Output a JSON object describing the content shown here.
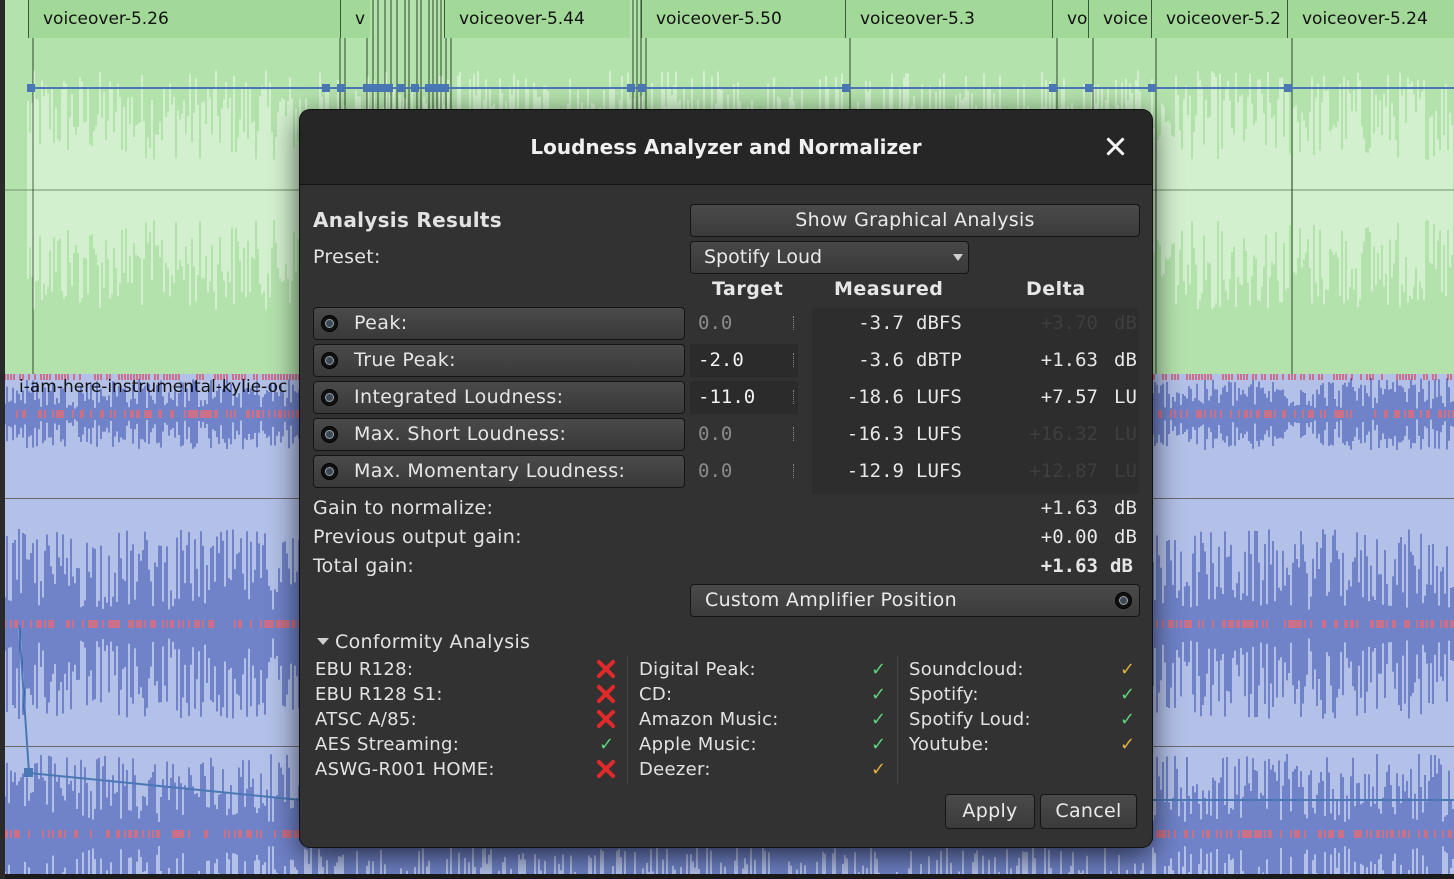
{
  "editor": {
    "voice_regions": [
      {
        "name": "voiceover-5.26"
      },
      {
        "name": "v"
      },
      {
        "name": "voiceover-5.44"
      },
      {
        "name": "voiceover-5.50"
      },
      {
        "name": "voiceover-5.3"
      },
      {
        "name": "vo"
      },
      {
        "name": "voice"
      },
      {
        "name": "voiceover-5.2"
      },
      {
        "name": "voiceover-5.24"
      }
    ],
    "music_region": "i-am-here-instrumental-kylie-oc",
    "colors": {
      "voice_track": "#b4e2ad",
      "voice_wave": "#f2fff0",
      "music_track": "#b3c0e8",
      "music_wave": "#2c44a8",
      "clip_marks": "#e0202a",
      "envelope": "#4a78b5"
    }
  },
  "dialog": {
    "title": "Loudness Analyzer and Normalizer",
    "analysis_results": "Analysis Results",
    "show_graph_button": "Show Graphical Analysis",
    "preset_label": "Preset:",
    "preset_value": "Spotify Loud",
    "col_target": "Target",
    "col_measured": "Measured",
    "col_delta": "Delta",
    "rows": [
      {
        "label": "Peak:",
        "target": "0.0",
        "measured": "-3.7",
        "unit": "dBFS",
        "delta": "+3.70",
        "delta_unit": "dB"
      },
      {
        "label": "True Peak:",
        "target": "-2.0",
        "measured": "-3.6",
        "unit": "dBTP",
        "delta": "+1.63",
        "delta_unit": "dB"
      },
      {
        "label": "Integrated Loudness:",
        "target": "-11.0",
        "measured": "-18.6",
        "unit": "LUFS",
        "delta": "+7.57",
        "delta_unit": "LU"
      },
      {
        "label": "Max. Short Loudness:",
        "target": "0.0",
        "measured": "-16.3",
        "unit": "LUFS",
        "delta": "+16.32",
        "delta_unit": "LU"
      },
      {
        "label": "Max. Momentary Loudness:",
        "target": "0.0",
        "measured": "-12.9",
        "unit": "LUFS",
        "delta": "+12.87",
        "delta_unit": "LU"
      }
    ],
    "gain_normalize_label": "Gain to normalize:",
    "gain_normalize_value": "+1.63",
    "prev_output_label": "Previous output gain:",
    "prev_output_value": "+0.00",
    "total_gain_label": "Total gain:",
    "total_gain_value": "+1.63",
    "db_unit": "dB",
    "custom_amp_button": "Custom Amplifier Position",
    "conformity_title": "Conformity Analysis",
    "conformity": [
      {
        "label": "EBU R128:",
        "status": "fail"
      },
      {
        "label": "EBU R128 S1:",
        "status": "fail"
      },
      {
        "label": "ATSC A/85:",
        "status": "fail"
      },
      {
        "label": "AES Streaming:",
        "status": "pass"
      },
      {
        "label": "ASWG-R001 HOME:",
        "status": "fail"
      },
      {
        "label": "Digital Peak:",
        "status": "pass"
      },
      {
        "label": "CD:",
        "status": "pass"
      },
      {
        "label": "Amazon Music:",
        "status": "pass"
      },
      {
        "label": "Apple Music:",
        "status": "pass"
      },
      {
        "label": "Deezer:",
        "status": "warn"
      },
      {
        "label": "Soundcloud:",
        "status": "warn"
      },
      {
        "label": "Spotify:",
        "status": "pass"
      },
      {
        "label": "Spotify Loud:",
        "status": "pass"
      },
      {
        "label": "Youtube:",
        "status": "warn"
      }
    ],
    "apply_button": "Apply",
    "cancel_button": "Cancel"
  }
}
